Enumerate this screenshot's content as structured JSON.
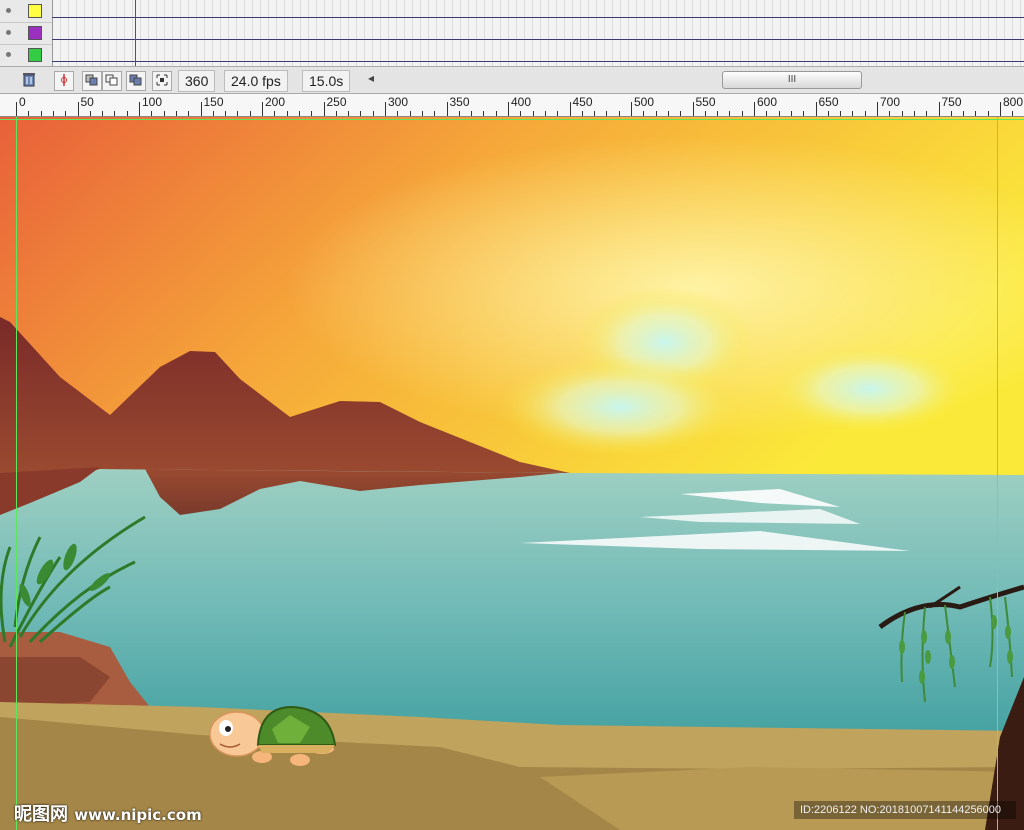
{
  "timeline": {
    "layers": [
      {
        "color": "#ffff44"
      },
      {
        "color": "#9a2fc0"
      },
      {
        "color": "#33cc44"
      }
    ]
  },
  "toolbar": {
    "current_frame": "360",
    "fps": "24.0 fps",
    "elapsed": "15.0s",
    "scroll_left_arrow": "◂",
    "scroll_grip": "III",
    "icons": [
      "trash-icon",
      "center-frame-icon",
      "onion-skin-icon",
      "onion-skin-outlines-icon",
      "edit-multiple-frames-icon",
      "modify-markers-icon"
    ]
  },
  "ruler": {
    "labels": [
      "0",
      "50",
      "100",
      "150",
      "200",
      "250",
      "300",
      "350",
      "400",
      "450",
      "500",
      "550",
      "600",
      "650",
      "700",
      "750",
      "800"
    ]
  },
  "stage": {
    "sky_colors": [
      "#e8603a",
      "#f6a93a",
      "#fbe93a"
    ],
    "water_color": "#6fb9b6",
    "mountain_color": "#8a3a2a",
    "ground_color": "#b8a060"
  },
  "watermark": {
    "site_cn": "昵图网",
    "site_url": "www.nipic.com",
    "id_text": "ID:2206122 NO:20181007141144256000"
  }
}
